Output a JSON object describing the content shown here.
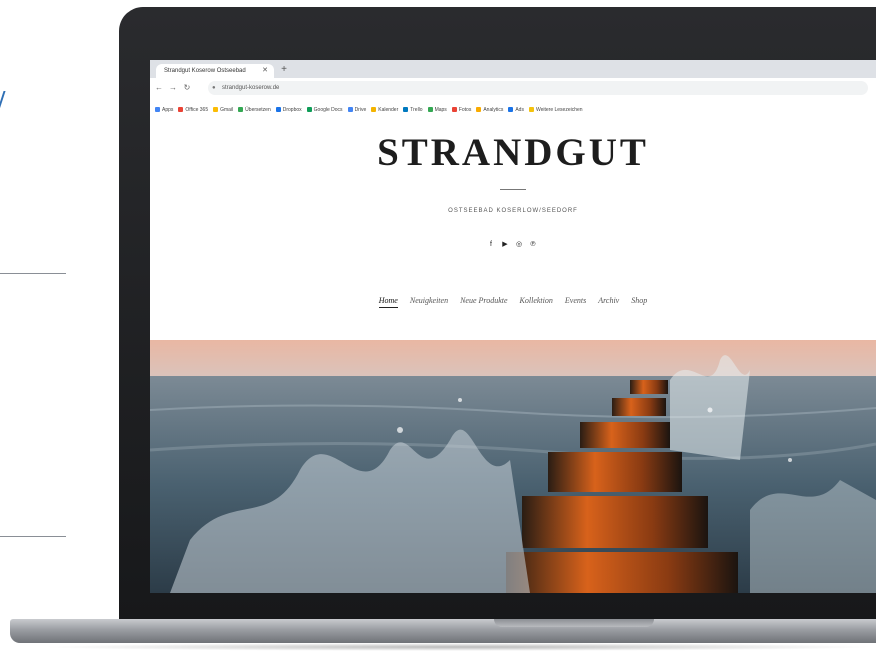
{
  "browser": {
    "tab_title": "Strandgut Koserow Ostseebad",
    "url": "strandgut-koserow.de",
    "bookmarks": [
      "Apps",
      "Office 365",
      "Gmail",
      "Übersetzen",
      "Dropbox",
      "Google Docs",
      "Drive",
      "Kalender",
      "Trello",
      "Maps",
      "Fotos",
      "Analytics",
      "Ads",
      "Weitere Lesezeichen"
    ]
  },
  "site": {
    "logo": "STRANDGUT",
    "tagline": "OSTSEEBAD KOSERLOW/SEEDORF",
    "social": [
      "facebook-icon",
      "youtube-icon",
      "instagram-icon",
      "pinterest-icon"
    ],
    "nav": [
      "Home",
      "Neuigkeiten",
      "Neue Produkte",
      "Kollektion",
      "Events",
      "Archiv",
      "Shop"
    ],
    "active_nav": "Home"
  },
  "colors": {
    "laptop_body": "#1f2022",
    "sky_top": "#e9b7a3",
    "sea": "#4a6170",
    "post_orange": "#d8621b"
  }
}
